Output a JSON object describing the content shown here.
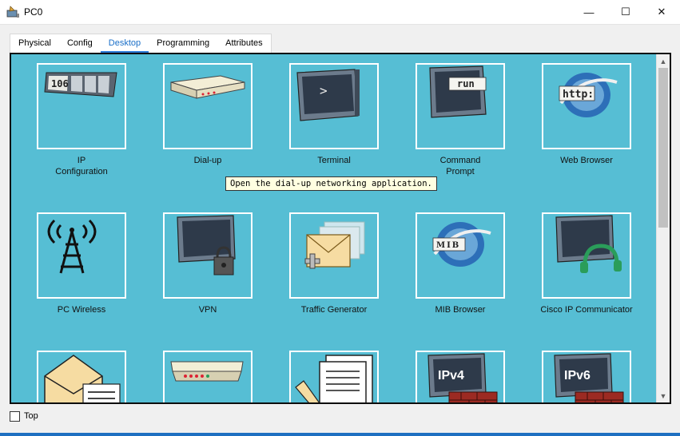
{
  "window": {
    "title": "PC0",
    "app_icon": "packet-tracer-pc-icon"
  },
  "controls": {
    "minimize": "—",
    "maximize": "☐",
    "close": "✕"
  },
  "tabs": [
    {
      "label": "Physical",
      "active": false
    },
    {
      "label": "Config",
      "active": false
    },
    {
      "label": "Desktop",
      "active": true
    },
    {
      "label": "Programming",
      "active": false
    },
    {
      "label": "Attributes",
      "active": false
    }
  ],
  "desktop": {
    "apps": [
      {
        "label_line1": "IP",
        "label_line2": "Configuration",
        "icon": "ip-configuration-icon",
        "icon_text": "106"
      },
      {
        "label_line1": "Dial-up",
        "label_line2": "",
        "icon": "dial-up-icon"
      },
      {
        "label_line1": "Terminal",
        "label_line2": "",
        "icon": "terminal-icon",
        "icon_text": ">"
      },
      {
        "label_line1": "Command",
        "label_line2": "Prompt",
        "icon": "command-prompt-icon",
        "icon_text": "run"
      },
      {
        "label_line1": "Web Browser",
        "label_line2": "",
        "icon": "web-browser-icon",
        "icon_text": "http:"
      },
      {
        "label_line1": "PC Wireless",
        "label_line2": "",
        "icon": "pc-wireless-icon"
      },
      {
        "label_line1": "VPN",
        "label_line2": "",
        "icon": "vpn-icon"
      },
      {
        "label_line1": "Traffic Generator",
        "label_line2": "",
        "icon": "traffic-generator-icon"
      },
      {
        "label_line1": "MIB Browser",
        "label_line2": "",
        "icon": "mib-browser-icon",
        "icon_text": "MIB"
      },
      {
        "label_line1": "Cisco IP Communicator",
        "label_line2": "",
        "icon": "cisco-ip-communicator-icon"
      },
      {
        "icon": "email-icon"
      },
      {
        "icon": "pppoe-dialer-icon"
      },
      {
        "icon": "text-editor-icon"
      },
      {
        "icon": "ipv4-firewall-icon",
        "icon_text": "IPv4"
      },
      {
        "icon": "ipv6-firewall-icon",
        "icon_text": "IPv6"
      }
    ]
  },
  "tooltip": {
    "text": "Open the dial-up networking application."
  },
  "footer": {
    "top_label": "Top",
    "top_checked": false
  },
  "scrollbar": {
    "up": "▲",
    "down": "▼"
  }
}
